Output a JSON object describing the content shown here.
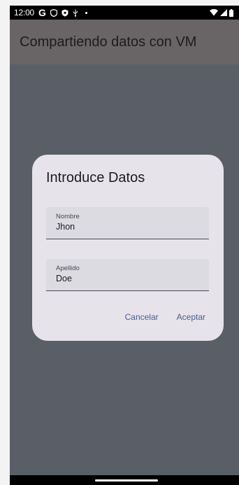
{
  "status_bar": {
    "time": "12:00",
    "icons": [
      "google-g-icon",
      "shield-icon",
      "vpn-shield-icon",
      "usb-icon",
      "dot-icon",
      "wifi-icon",
      "signal-icon",
      "battery-icon"
    ]
  },
  "app_bar": {
    "title": "Compartiendo datos con VM"
  },
  "dialog": {
    "title": "Introduce Datos",
    "fields": [
      {
        "label": "Nombre",
        "value": "Jhon"
      },
      {
        "label": "Apellido",
        "value": "Doe"
      }
    ],
    "cancel_label": "Cancelar",
    "accept_label": "Aceptar"
  },
  "colors": {
    "scrim": "#5a5e67",
    "app_bar": "#696566",
    "dialog_surface": "#e6e4ea",
    "field_surface": "#dddbe2",
    "button_text": "#4a5b8f"
  }
}
